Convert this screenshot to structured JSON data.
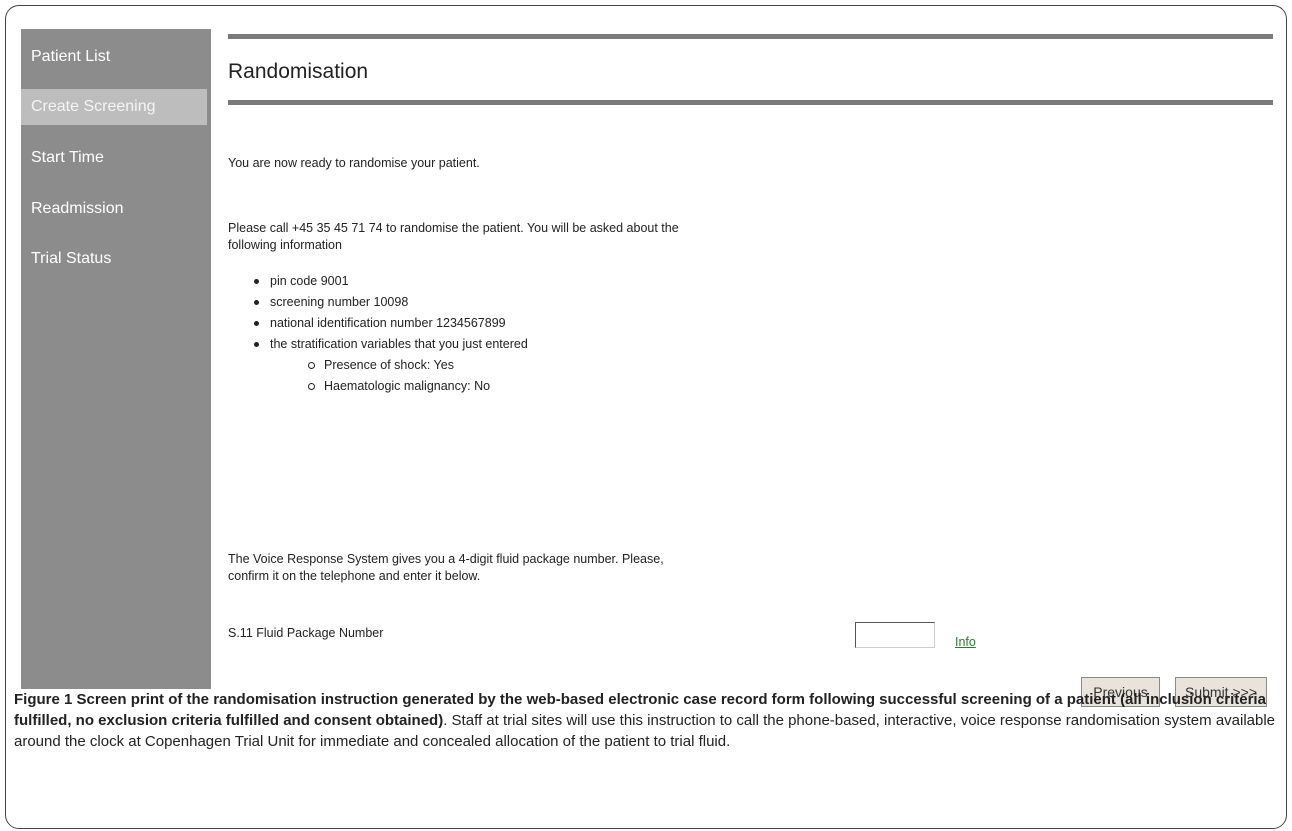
{
  "sidebar": {
    "items": [
      {
        "label": "Patient List",
        "active": false
      },
      {
        "label": "Create Screening",
        "active": true
      },
      {
        "label": "Start Time",
        "active": false
      },
      {
        "label": "Readmission",
        "active": false
      },
      {
        "label": "Trial Status",
        "active": false
      }
    ]
  },
  "page": {
    "title": "Randomisation",
    "ready_text": "You are now ready to randomise your patient.",
    "call_text_line1": "Please call +45 35 45 71 74 to randomise the patient. You will be asked about the",
    "call_text_line2": "following information",
    "bullets": [
      "pin code 9001",
      "screening number 10098",
      "national identification number 1234567899",
      "the stratification variables that you just entered"
    ],
    "sub_bullets": [
      "Presence of shock: Yes",
      "Haematologic malignancy: No"
    ],
    "voice_text_line1": "The Voice Response System gives you a 4-digit fluid package number. Please,",
    "voice_text_line2": "confirm it on the telephone and enter it below.",
    "field_label": "S.11 Fluid Package Number",
    "field_value": "",
    "info_link": "Info",
    "previous_button": "Previous",
    "submit_button": "Submit >>>"
  },
  "caption": {
    "bold": "Figure 1 Screen print of the randomisation instruction generated by the web-based electronic case record form following successful screening of a patient (all inclusion criteria fulfilled, no exclusion criteria fulfilled and consent obtained)",
    "normal": ". Staff at trial sites will use this instruction to call the phone-based, interactive, voice response randomisation system available around the clock at Copenhagen Trial Unit for immediate and concealed allocation of the patient to trial fluid."
  },
  "colors": {
    "sidebar_bg": "#8c8c8c",
    "sidebar_active_bg": "#bdbdbd",
    "rule": "#7a7a7a",
    "link": "#2f7a2f",
    "button_bg": "#e9e3db"
  }
}
